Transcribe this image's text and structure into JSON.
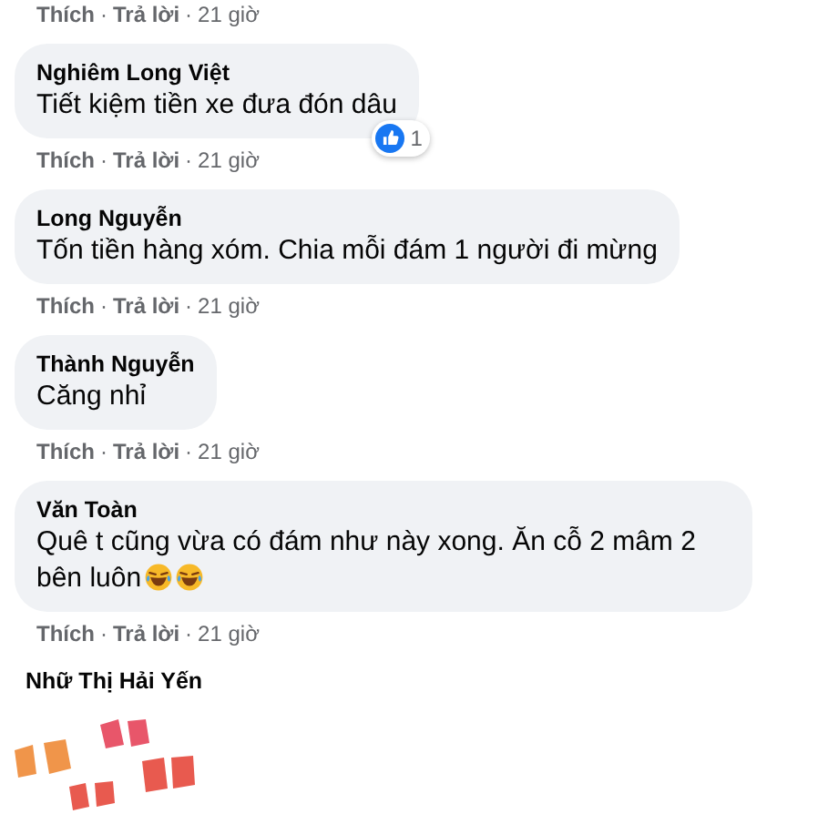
{
  "top_actions": {
    "like": "Thích",
    "sep": "·",
    "reply": "Trả lời",
    "time": "21 giờ"
  },
  "comments": [
    {
      "author": "Nghiêm Long Việt",
      "text": "Tiết kiệm tiền xe đưa đón dâu",
      "reactions": {
        "count": "1"
      },
      "actions": {
        "like": "Thích",
        "sep": "·",
        "reply": "Trả lời",
        "time": "21 giờ"
      }
    },
    {
      "author": "Long Nguyễn",
      "text": "Tốn tiền hàng xóm. Chia mỗi đám 1 người đi mừng",
      "actions": {
        "like": "Thích",
        "sep": "·",
        "reply": "Trả lời",
        "time": "21 giờ"
      }
    },
    {
      "author": "Thành Nguyễn",
      "text": "Căng nhỉ",
      "actions": {
        "like": "Thích",
        "sep": "·",
        "reply": "Trả lời",
        "time": "21 giờ"
      }
    },
    {
      "author": "Văn Toàn",
      "text": "Quê t cũng vừa có đám như này xong. Ăn cỗ 2 mâm 2 bên luôn",
      "emojis": [
        {
          "kind": "laugh"
        },
        {
          "kind": "laugh"
        }
      ],
      "actions": {
        "like": "Thích",
        "sep": "·",
        "reply": "Trả lời",
        "time": "21 giờ"
      }
    }
  ],
  "sticker_comment": {
    "author": "Nhữ Thị Hải Yến"
  }
}
